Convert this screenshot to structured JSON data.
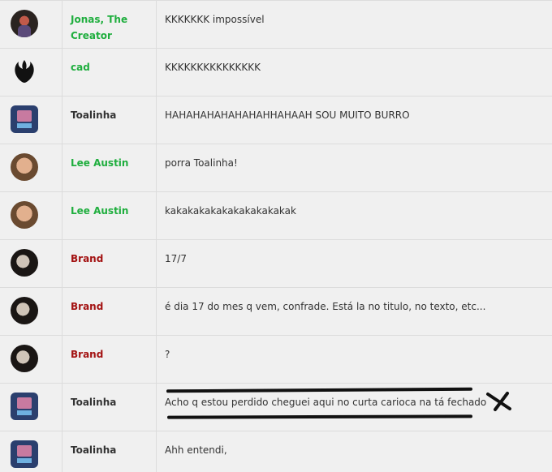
{
  "messages": [
    {
      "user": "Jonas, The Creator",
      "color": "green",
      "avatar": "jonas-avatar",
      "text": "KKKKKKK impossível"
    },
    {
      "user": "cad",
      "color": "green",
      "avatar": "rebel-alliance-icon",
      "text": "KKKKKKKKKKKKKKK"
    },
    {
      "user": "Toalinha",
      "color": "black",
      "avatar": "toalinha-avatar",
      "text": "HAHAHAHAHAHAHAHHAHAAH SOU MUITO BURRO"
    },
    {
      "user": "Lee Austin",
      "color": "green",
      "avatar": "lee-austin-avatar",
      "text": "porra Toalinha!"
    },
    {
      "user": "Lee Austin",
      "color": "green",
      "avatar": "lee-austin-avatar",
      "text": "kakakakakakakakakakakak"
    },
    {
      "user": "Brand",
      "color": "red",
      "avatar": "brand-avatar",
      "text": "17/7"
    },
    {
      "user": "Brand",
      "color": "red",
      "avatar": "brand-avatar",
      "text": "é dia 17 do mes q vem, confrade. Está la no titulo, no texto, etc..."
    },
    {
      "user": "Brand",
      "color": "red",
      "avatar": "brand-avatar",
      "text": "?"
    },
    {
      "user": "Toalinha",
      "color": "black",
      "avatar": "toalinha-avatar",
      "text": "Acho q estou perdido cheguei aqui no curta carioca na tá fechado"
    },
    {
      "user": "Toalinha",
      "color": "black",
      "avatar": "toalinha-avatar",
      "text": "Ahh entendi,"
    }
  ],
  "colors": {
    "green": "#1fae3e",
    "red": "#a31212",
    "black": "#333333"
  }
}
